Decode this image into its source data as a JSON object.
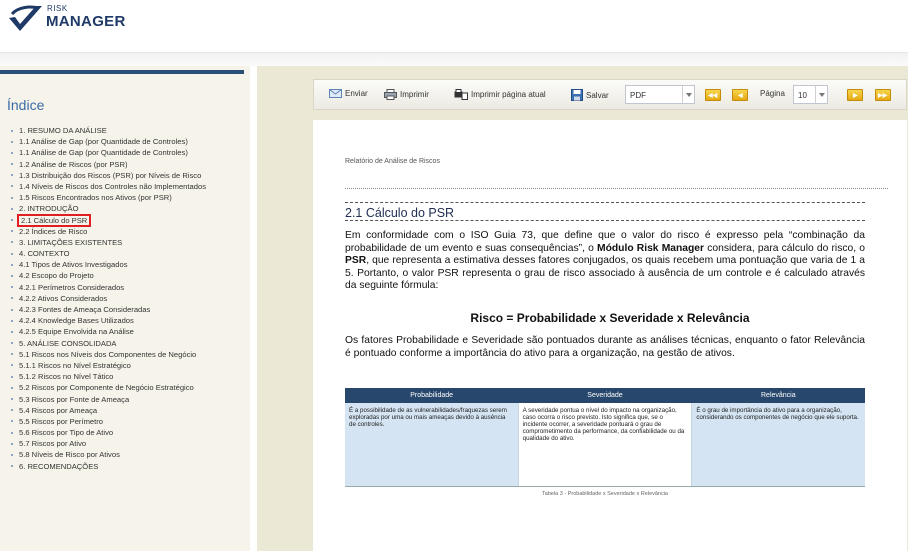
{
  "header": {
    "logo_small": "RISK",
    "logo_big": "MANAGER"
  },
  "sidebar": {
    "title": "Índice",
    "items": [
      "1. RESUMO DA ANÁLISE",
      "1.1 Análise de Gap (por Quantidade de Controles)",
      "1.1 Análise de Gap (por Quantidade de Controles)",
      "1.2 Análise de Riscos (por PSR)",
      "1.3 Distribuição dos Riscos (PSR) por Níveis de Risco",
      "1.4 Níveis de Riscos dos Controles não Implementados",
      "1.5 Riscos Encontrados nos Ativos (por PSR)",
      "2. INTRODUÇÃO",
      "2.1 Cálculo do PSR",
      "2.2 Índices de Risco",
      "3. LIMITAÇÕES EXISTENTES",
      "4. CONTEXTO",
      "4.1 Tipos de Ativos Investigados",
      "4.2 Escopo do Projeto",
      "4.2.1 Perímetros Considerados",
      "4.2.2 Ativos Considerados",
      "4.2.3 Fontes de Ameaça Consideradas",
      "4.2.4 Knowledge Bases Utilizados",
      "4.2.5 Equipe Envolvida na Análise",
      "5. ANÁLISE CONSOLIDADA",
      "5.1 Riscos nos Níveis dos Componentes de Negócio",
      "5.1.1 Riscos no Nível Estratégico",
      "5.1.2 Riscos no Nível Tático",
      "5.2 Riscos por Componente de Negócio Estratégico",
      "5.3 Riscos por Fonte de Ameaça",
      "5.4 Riscos por Ameaça",
      "5.5 Riscos por Perímetro",
      "5.6 Riscos por Tipo de Ativo",
      "5.7 Riscos por Ativo",
      "5.8 Níveis de Risco por Ativos",
      "6. RECOMENDAÇÕES"
    ]
  },
  "toolbar": {
    "send": "Enviar",
    "print": "Imprimir",
    "print_page": "Imprimir página atual",
    "save": "Salvar",
    "format": "PDF",
    "page_label": "Página",
    "page_value": "10"
  },
  "doc": {
    "header": "Relatório de Análise de Riscos",
    "section_title": "2.1 Cálculo do PSR",
    "p1_a": "Em conformidade com o ISO Guia 73, que define que o valor do risco é expresso pela “combinação da probabilidade de um evento e suas consequências”, o ",
    "p1_b": "Módulo Risk Manager",
    "p1_c": " considera, para cálculo do risco, o ",
    "p1_d": "PSR",
    "p1_e": ", que representa a estimativa desses fatores conjugados, os quais recebem uma pontuação que varia de 1 a 5. Portanto, o valor PSR representa o grau de risco associado à ausência de um controle e é calculado através da seguinte fórmula:",
    "formula": "Risco = Probabilidade x Severidade x Relevância",
    "p2": "Os fatores Probabilidade e Severidade são pontuados durante as análises técnicas, enquanto o fator Relevância é pontuado conforme a importância do ativo para a organização, na gestão de ativos.",
    "table": {
      "headers": [
        "Probabilidade",
        "Severidade",
        "Relevância"
      ],
      "cells": [
        "É a possibilidade de as vulnerabilidades/fraquezas serem exploradas por uma ou mais ameaças devido à ausência de controles.",
        "A severidade pontua o nível do impacto na organização, caso ocorra o risco previsto. Isto significa que, se o incidente ocorrer, a severidade pontuará o grau de comprometimento da performance, da confiabilidade ou da qualidade do ativo.",
        "É o grau de importância do ativo para a organização, considerando os componentes de negócio que ele suporta."
      ]
    },
    "caption": "Tabela 3 - Probabilidade x Severidade x Relevância"
  }
}
